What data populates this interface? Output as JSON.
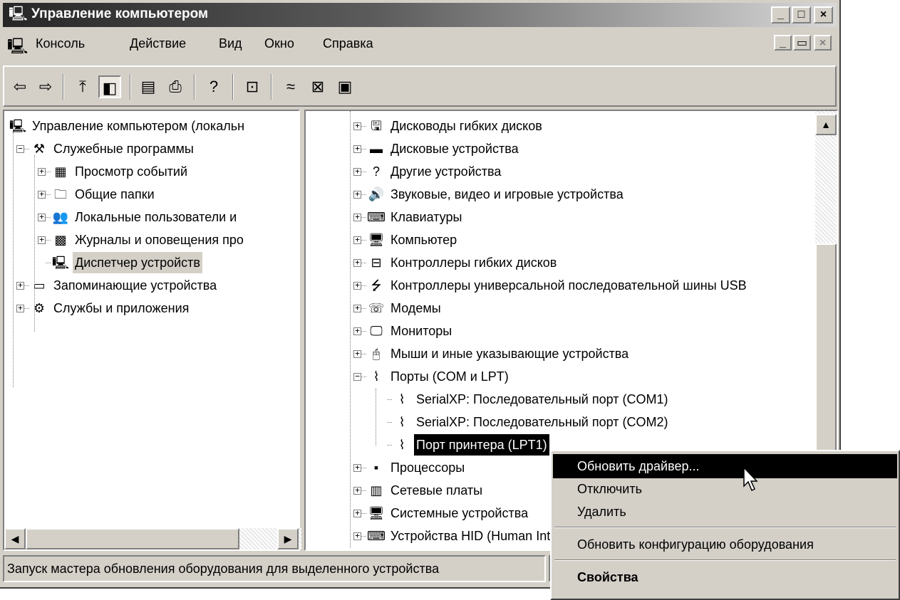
{
  "window": {
    "title": "Управление компьютером",
    "buttons": {
      "minimize": "_",
      "maximize": "□",
      "close": "×"
    }
  },
  "menubar": {
    "items": [
      "Консоль",
      "Действие",
      "Вид",
      "Окно",
      "Справка"
    ],
    "mdi_buttons": {
      "minimize": "_",
      "restore": "▭",
      "close": "×"
    }
  },
  "toolbar": {
    "buttons": [
      {
        "icon": "back-arrow-icon",
        "glyph": "⇦"
      },
      {
        "icon": "forward-arrow-icon",
        "glyph": "⇨"
      },
      {
        "icon": "up-folder-icon",
        "glyph": "⤒"
      },
      {
        "icon": "show-hide-tree-icon",
        "glyph": "◧"
      },
      {
        "icon": "properties-icon",
        "glyph": "▤"
      },
      {
        "icon": "print-icon",
        "glyph": "⎙"
      },
      {
        "icon": "help-icon",
        "glyph": "?"
      },
      {
        "icon": "scan-hardware-icon",
        "glyph": "⊡"
      },
      {
        "icon": "disconnect-icon",
        "glyph": "≈"
      },
      {
        "icon": "disable-device-icon",
        "glyph": "⊠"
      },
      {
        "icon": "uninstall-device-icon",
        "glyph": "▣"
      }
    ]
  },
  "left_tree": {
    "nodes": [
      {
        "label": "Управление компьютером (локальн",
        "icon": "computer-icon",
        "glyph": "🖳",
        "level": 0,
        "expander": ""
      },
      {
        "label": "Служебные программы",
        "icon": "tools-icon",
        "glyph": "⚒",
        "level": 1,
        "expander": "−"
      },
      {
        "label": "Просмотр событий",
        "icon": "event-viewer-icon",
        "glyph": "▦",
        "level": 2,
        "expander": "+"
      },
      {
        "label": "Общие папки",
        "icon": "shared-folder-icon",
        "glyph": "🗀",
        "level": 2,
        "expander": "+"
      },
      {
        "label": "Локальные пользователи и",
        "icon": "users-icon",
        "glyph": "👥",
        "level": 2,
        "expander": "+"
      },
      {
        "label": "Журналы и оповещения про",
        "icon": "performance-logs-icon",
        "glyph": "▩",
        "level": 2,
        "expander": "+"
      },
      {
        "label": "Диспетчер устройств",
        "icon": "device-manager-icon",
        "glyph": "🖳",
        "level": 2,
        "expander": "",
        "selected": true
      },
      {
        "label": "Запоминающие устройства",
        "icon": "storage-icon",
        "glyph": "▭",
        "level": 1,
        "expander": "+"
      },
      {
        "label": "Службы и приложения",
        "icon": "services-icon",
        "glyph": "⚙",
        "level": 1,
        "expander": "+"
      }
    ]
  },
  "right_tree": {
    "nodes": [
      {
        "label": "Дисководы гибких дисков",
        "icon": "floppy-drive-icon",
        "glyph": "🖫",
        "level": 0,
        "expander": "+"
      },
      {
        "label": "Дисковые устройства",
        "icon": "disk-drive-icon",
        "glyph": "▬",
        "level": 0,
        "expander": "+"
      },
      {
        "label": "Другие устройства",
        "icon": "unknown-device-icon",
        "glyph": "?",
        "level": 0,
        "expander": "+"
      },
      {
        "label": "Звуковые, видео и игровые устройства",
        "icon": "sound-icon",
        "glyph": "🔊",
        "level": 0,
        "expander": "+"
      },
      {
        "label": "Клавиатуры",
        "icon": "keyboard-icon",
        "glyph": "⌨",
        "level": 0,
        "expander": "+"
      },
      {
        "label": "Компьютер",
        "icon": "computer-icon",
        "glyph": "🖥",
        "level": 0,
        "expander": "+"
      },
      {
        "label": "Контроллеры гибких дисков",
        "icon": "floppy-controller-icon",
        "glyph": "⊟",
        "level": 0,
        "expander": "+"
      },
      {
        "label": "Контроллеры универсальной последовательной шины USB",
        "icon": "usb-icon",
        "glyph": "⭍",
        "level": 0,
        "expander": "+"
      },
      {
        "label": "Модемы",
        "icon": "modem-icon",
        "glyph": "☏",
        "level": 0,
        "expander": "+"
      },
      {
        "label": "Мониторы",
        "icon": "monitor-icon",
        "glyph": "🖵",
        "level": 0,
        "expander": "+"
      },
      {
        "label": "Мыши и иные указывающие устройства",
        "icon": "mouse-icon",
        "glyph": "🖰",
        "level": 0,
        "expander": "+"
      },
      {
        "label": "Порты (COM и LPT)",
        "icon": "port-icon",
        "glyph": "⌇",
        "level": 0,
        "expander": "−"
      },
      {
        "label": "SerialXP: Последовательный порт (COM1)",
        "icon": "port-icon",
        "glyph": "⌇",
        "level": 1,
        "expander": ""
      },
      {
        "label": "SerialXP: Последовательный порт (COM2)",
        "icon": "port-icon",
        "glyph": "⌇",
        "level": 1,
        "expander": ""
      },
      {
        "label": "Порт принтера (LPT1)",
        "icon": "port-icon",
        "glyph": "⌇",
        "level": 1,
        "expander": "",
        "selected": true
      },
      {
        "label": "Процессоры",
        "icon": "processor-icon",
        "glyph": "▪",
        "level": 0,
        "expander": "+"
      },
      {
        "label": "Сетевые платы",
        "icon": "network-card-icon",
        "glyph": "▥",
        "level": 0,
        "expander": "+"
      },
      {
        "label": "Системные устройства",
        "icon": "system-device-icon",
        "glyph": "🖥",
        "level": 0,
        "expander": "+"
      },
      {
        "label": "Устройства HID (Human Interface Devices)",
        "icon": "hid-icon",
        "glyph": "⌨",
        "level": 0,
        "expander": "+"
      }
    ]
  },
  "context_menu": {
    "items": [
      {
        "label": "Обновить драйвер...",
        "highlighted": true,
        "bold": false
      },
      {
        "label": "Отключить",
        "highlighted": false,
        "bold": false
      },
      {
        "label": "Удалить",
        "highlighted": false,
        "bold": false
      },
      {
        "separator": true
      },
      {
        "label": "Обновить конфигурацию оборудования",
        "highlighted": false,
        "bold": false
      },
      {
        "separator": true
      },
      {
        "label": "Свойства",
        "highlighted": false,
        "bold": true
      }
    ]
  },
  "statusbar": {
    "text": "Запуск мастера обновления оборудования для выделенного устройства"
  },
  "scroll": {
    "left_h_arrows": {
      "left": "◀",
      "right": "▶"
    },
    "right_v_arrows": {
      "up": "▲"
    }
  },
  "colors": {
    "face": "#d4d0c8",
    "selection": "#000000",
    "title_gradient_start": "#262626"
  }
}
